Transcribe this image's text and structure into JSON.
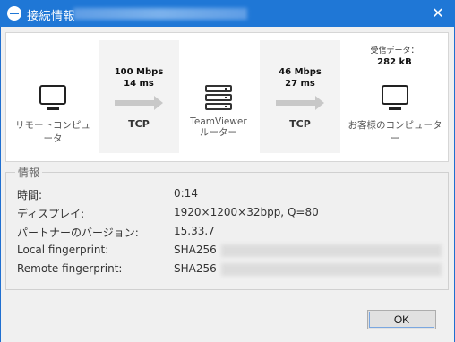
{
  "window": {
    "title": "接続情報",
    "close_glyph": "✕"
  },
  "diagram": {
    "local_label": "リモートコンピュータ",
    "router_label_line1": "TeamViewer",
    "router_label_line2": "ルーター",
    "remote_label": "お客様のコンピューター",
    "link1": {
      "bandwidth": "100 Mbps",
      "latency": "14 ms",
      "protocol": "TCP"
    },
    "link2": {
      "bandwidth": "46 Mbps",
      "latency": "27 ms",
      "protocol": "TCP"
    },
    "received_label": "受信データ：",
    "received_value": "282 kB"
  },
  "info": {
    "title": "情報",
    "rows": [
      {
        "key": "時間:",
        "value": "0:14"
      },
      {
        "key": "ディスプレイ:",
        "value": "1920×1200×32bpp, Q=80"
      },
      {
        "key": "パートナーのバージョン:",
        "value": "15.33.7"
      },
      {
        "key": "Local fingerprint:",
        "value": "SHA256"
      },
      {
        "key": "Remote fingerprint:",
        "value": "SHA256"
      }
    ]
  },
  "footer": {
    "ok_label": "OK"
  }
}
